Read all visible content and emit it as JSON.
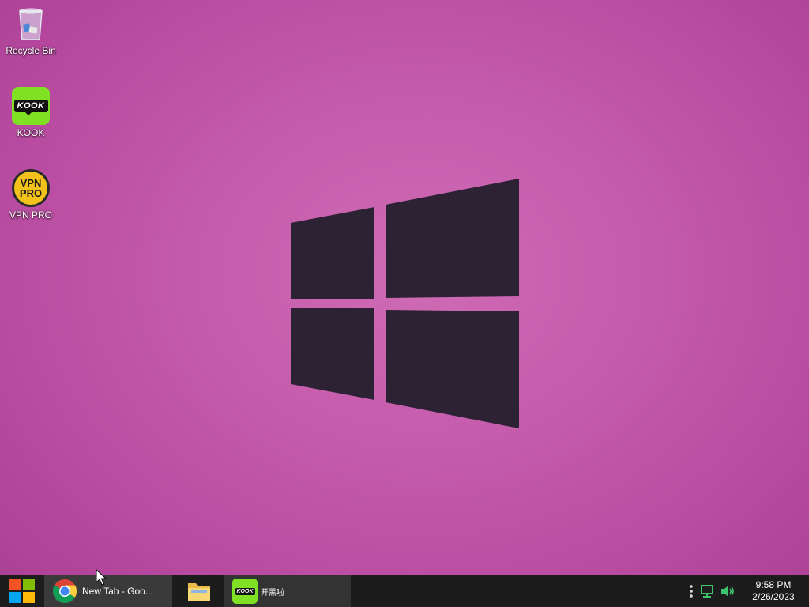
{
  "desktop": {
    "icons": [
      {
        "label": "Recycle Bin",
        "icon": "recycle-bin-icon"
      },
      {
        "label": "KOOK",
        "icon": "kook-icon",
        "badge": "KOOK"
      },
      {
        "label": "VPN PRO",
        "icon": "vpn-pro-icon",
        "badge_line1": "VPN",
        "badge_line2": "PRO"
      }
    ]
  },
  "taskbar": {
    "start_icon": "windows-start-icon",
    "apps": [
      {
        "title": "New Tab - Goo...",
        "icon": "chrome-icon",
        "active": true
      },
      {
        "title": "",
        "icon": "file-explorer-icon",
        "active": false
      },
      {
        "title": "开黑啦",
        "icon": "kook-icon",
        "badge": "KOOK",
        "active": false
      }
    ],
    "tray": {
      "overflow_icon": "more-vertical-icon",
      "network_icon": "network-icon",
      "volume_icon": "volume-icon",
      "time": "9:58 PM",
      "date": "2/26/2023"
    }
  },
  "colors": {
    "wallpaper": "#c45aab",
    "logo": "#2d2234",
    "taskbar": "#1c1c1c",
    "kook_green": "#7fe024",
    "vpn_yellow": "#f2c21b",
    "tray_green": "#3ec46d"
  }
}
